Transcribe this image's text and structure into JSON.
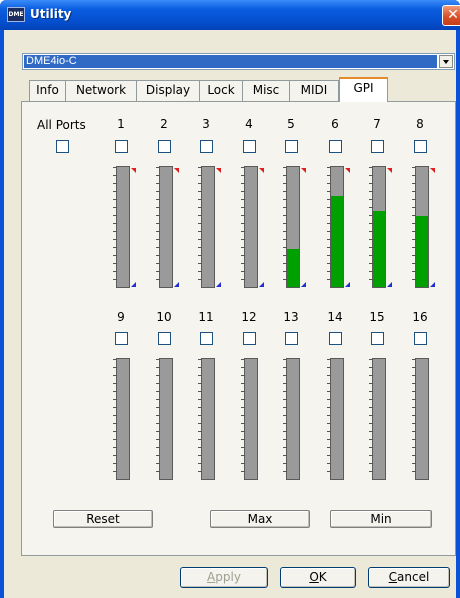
{
  "window": {
    "title": "Utility",
    "app_icon_text": "DME",
    "close_symbol": "✕"
  },
  "device_select": {
    "value": "DME4io-C"
  },
  "tabs": [
    {
      "label": "Info",
      "active": false
    },
    {
      "label": "Network",
      "active": false
    },
    {
      "label": "Display",
      "active": false
    },
    {
      "label": "Lock",
      "active": false
    },
    {
      "label": "Misc",
      "active": false
    },
    {
      "label": "MIDI",
      "active": false
    },
    {
      "label": "GPI",
      "active": true
    }
  ],
  "gpi": {
    "all_ports_label": "All Ports",
    "all_ports_checked": false,
    "ports": [
      {
        "label": "1",
        "checked": false,
        "level": 0.0
      },
      {
        "label": "2",
        "checked": false,
        "level": 0.0
      },
      {
        "label": "3",
        "checked": false,
        "level": 0.0
      },
      {
        "label": "4",
        "checked": false,
        "level": 0.0
      },
      {
        "label": "5",
        "checked": false,
        "level": 0.32
      },
      {
        "label": "6",
        "checked": false,
        "level": 0.76
      },
      {
        "label": "7",
        "checked": false,
        "level": 0.63
      },
      {
        "label": "8",
        "checked": false,
        "level": 0.59
      },
      {
        "label": "9",
        "checked": false,
        "level": 0.0
      },
      {
        "label": "10",
        "checked": false,
        "level": 0.0
      },
      {
        "label": "11",
        "checked": false,
        "level": 0.0
      },
      {
        "label": "12",
        "checked": false,
        "level": 0.0
      },
      {
        "label": "13",
        "checked": false,
        "level": 0.0
      },
      {
        "label": "14",
        "checked": false,
        "level": 0.0
      },
      {
        "label": "15",
        "checked": false,
        "level": 0.0
      },
      {
        "label": "16",
        "checked": false,
        "level": 0.0
      }
    ],
    "level_color": "#00a000"
  },
  "buttons": {
    "reset": "Reset",
    "max": "Max",
    "min": "Min"
  },
  "footer": {
    "apply": {
      "label": "Apply",
      "accel": "A",
      "enabled": false
    },
    "ok": {
      "label": "OK",
      "accel": "O",
      "enabled": true
    },
    "cancel": {
      "label": "Cancel",
      "accel": "C",
      "enabled": true
    }
  }
}
